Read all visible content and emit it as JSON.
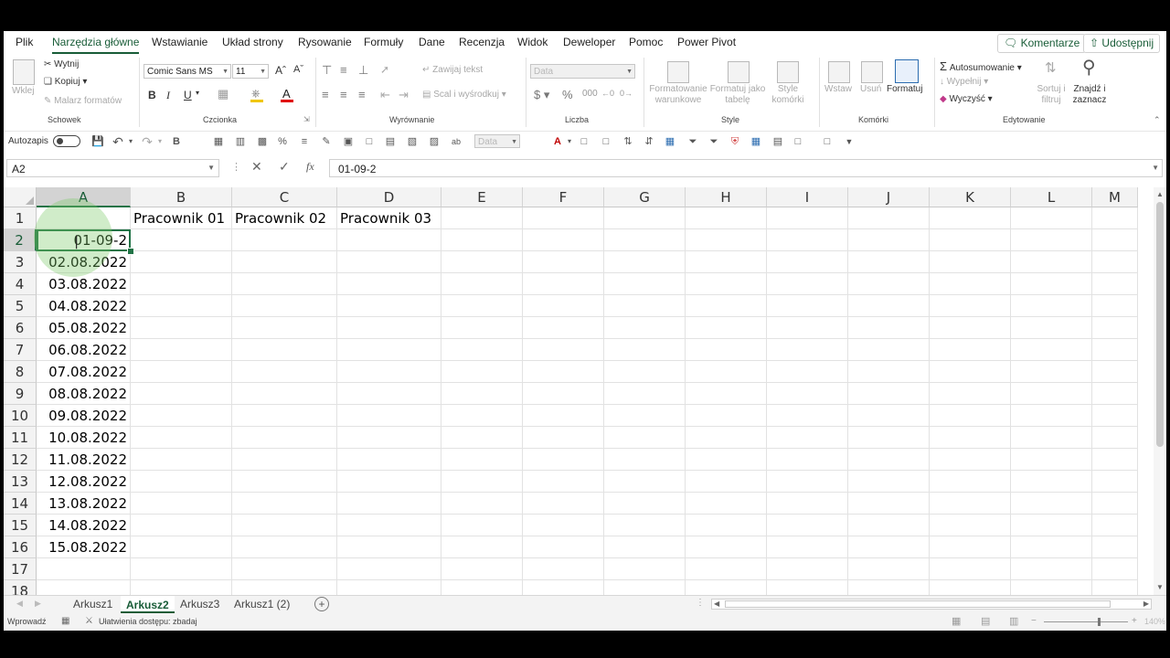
{
  "menu": {
    "tabs": [
      "Plik",
      "Narzędzia główne",
      "Wstawianie",
      "Układ strony",
      "Rysowanie",
      "Formuły",
      "Dane",
      "Recenzja",
      "Widok",
      "Deweloper",
      "Pomoc",
      "Power Pivot"
    ],
    "active_tab": "Narzędzia główne",
    "comments_label": "Komentarze",
    "share_label": "Udostępnij"
  },
  "ribbon": {
    "clipboard": {
      "paste": "Wklej",
      "cut": "Wytnij",
      "copy": "Kopiuj",
      "format_painter": "Malarz formatów",
      "label": "Schowek"
    },
    "font": {
      "name": "Comic Sans MS",
      "size": "11",
      "bold": "B",
      "italic": "I",
      "underline": "U",
      "label": "Czcionka"
    },
    "alignment": {
      "wrap": "Zawijaj tekst",
      "merge": "Scal i wyśrodkuj",
      "label": "Wyrównanie"
    },
    "number": {
      "format": "Data",
      "label": "Liczba"
    },
    "styles": {
      "cond_format": "Formatowanie warunkowe",
      "format_table": "Formatuj jako tabelę",
      "cell_styles": "Style komórki",
      "label": "Style"
    },
    "cells": {
      "insert": "Wstaw",
      "delete": "Usuń",
      "format": "Formatuj",
      "label": "Komórki"
    },
    "editing": {
      "autosum": "Autosumowanie",
      "fill": "Wypełnij",
      "clear": "Wyczyść",
      "sort": "Sortuj i filtruj",
      "find": "Znajdź i zaznacz",
      "label": "Edytowanie"
    }
  },
  "qat": {
    "autosave_label": "Autozapis",
    "number_format": "Data"
  },
  "formula_bar": {
    "name_box": "A2",
    "formula": "01-09-2",
    "fx": "fx"
  },
  "grid": {
    "columns": [
      "A",
      "B",
      "C",
      "D",
      "E",
      "F",
      "G",
      "H",
      "I",
      "J",
      "K",
      "L",
      "M"
    ],
    "selected_column": "A",
    "selected_row": "2",
    "row_numbers": [
      "1",
      "2",
      "3",
      "4",
      "5",
      "6",
      "7",
      "8",
      "9",
      "10",
      "11",
      "12",
      "13",
      "14",
      "15",
      "16",
      "17",
      "18"
    ],
    "header_row": [
      "Pracownik 01",
      "Pracownik 02",
      "Pracownik 03"
    ],
    "column_a": [
      "",
      "01-09-2",
      "02.08.2022",
      "03.08.2022",
      "04.08.2022",
      "05.08.2022",
      "06.08.2022",
      "07.08.2022",
      "08.08.2022",
      "09.08.2022",
      "10.08.2022",
      "11.08.2022",
      "12.08.2022",
      "13.08.2022",
      "14.08.2022",
      "15.08.2022",
      "",
      ""
    ]
  },
  "sheets": {
    "tabs": [
      "Arkusz1",
      "Arkusz2",
      "Arkusz3",
      "Arkusz1 (2)"
    ],
    "active": "Arkusz2"
  },
  "status": {
    "mode": "Wprowadź",
    "accessibility": "Ułatwienia dostępu: zbadaj",
    "zoom": "140%"
  }
}
